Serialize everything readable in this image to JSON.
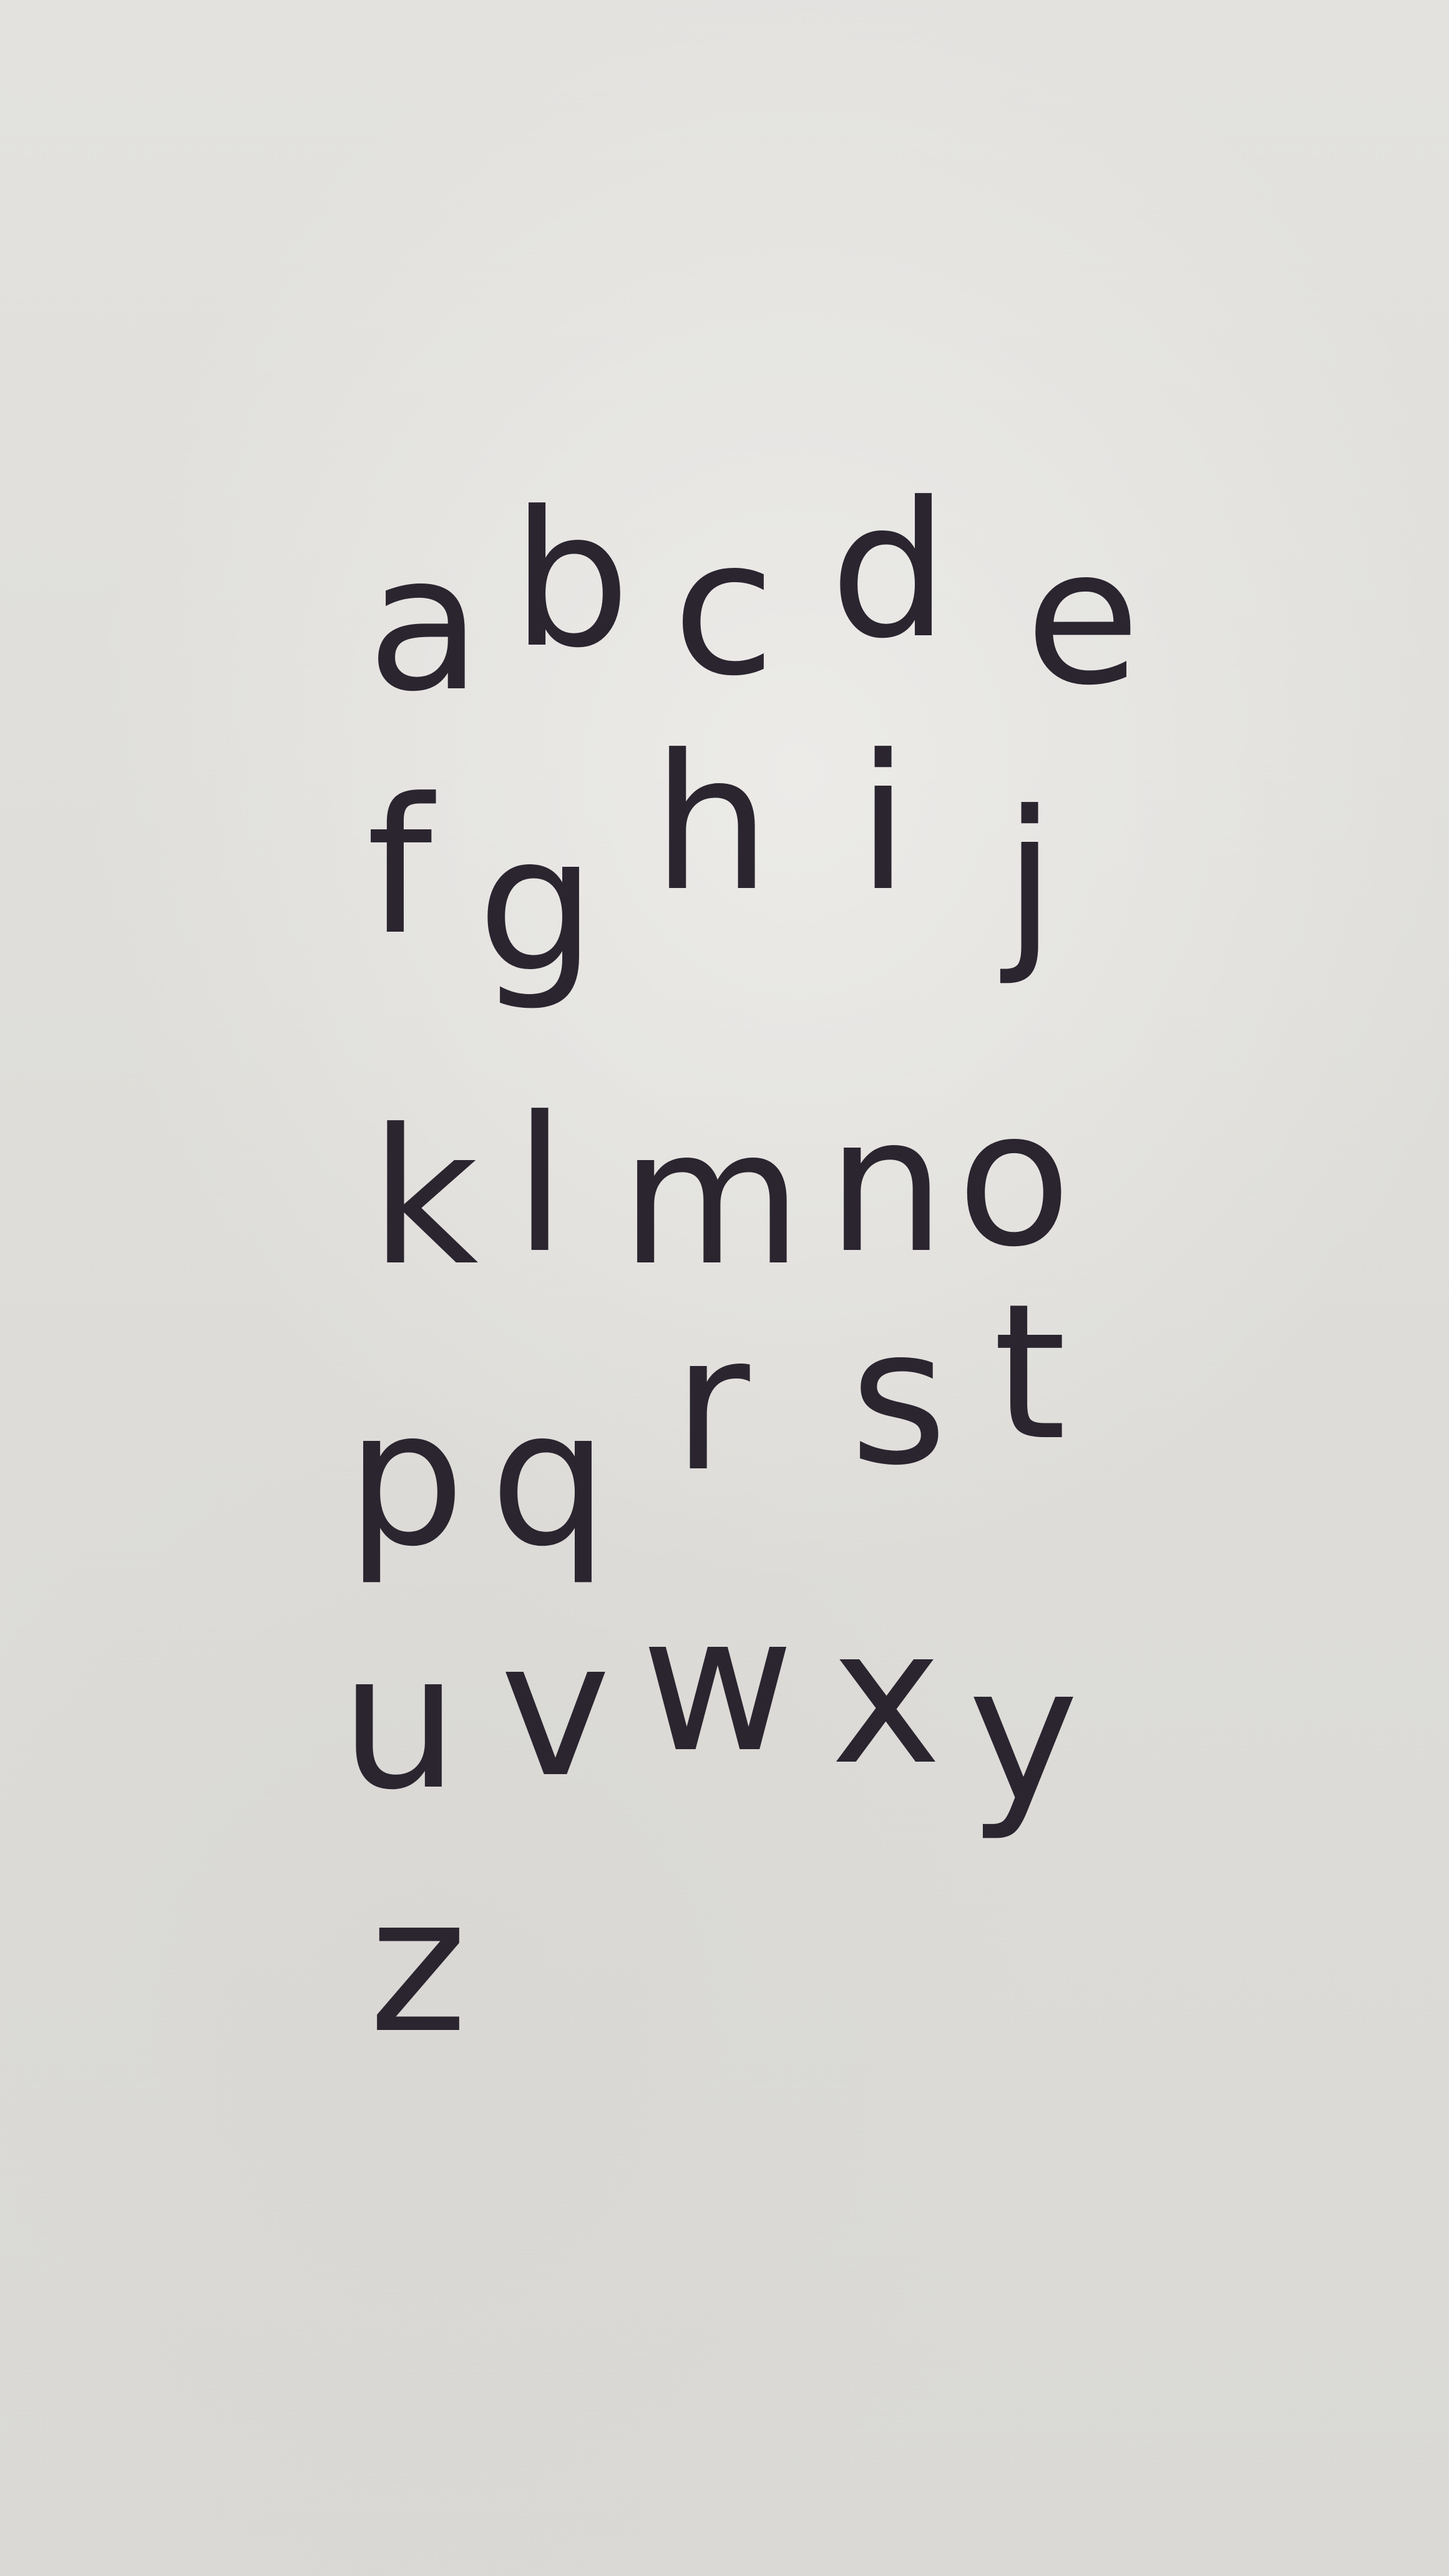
{
  "rows": [
    [
      "a",
      "b",
      "c",
      "d",
      "e"
    ],
    [
      "f",
      "g",
      "h",
      "i",
      "j"
    ],
    [
      "k",
      "l",
      "m",
      "n",
      "o"
    ],
    [
      "p",
      "q",
      "r",
      "s",
      "t"
    ],
    [
      "u",
      "v",
      "w",
      "x",
      "y"
    ],
    [
      "z"
    ]
  ],
  "colors": {
    "ink": "#2b2530",
    "paper": "#e3e2df"
  }
}
